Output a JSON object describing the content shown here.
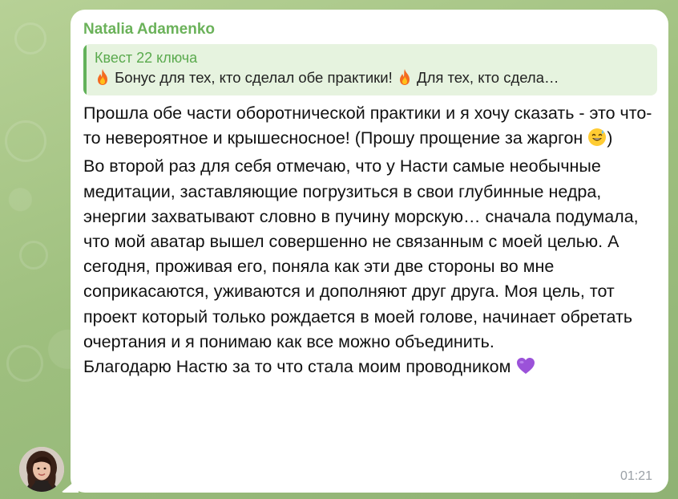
{
  "chat": {
    "sender_name": "Natalia Adamenko",
    "reply": {
      "title": "Квест 22 ключа",
      "text": "Бонус для тех, кто сделал обе практики!",
      "text_tail": "Для тех, кто сдела…"
    },
    "message": {
      "line_1": "Прошла обе части оборотнической практики и я хочу сказать - это что-то невероятное и крышесносное! (Прошу прощение за жаргон",
      "line_1_end": ")",
      "line_2": "Во второй раз для себя отмечаю, что у Насти самые необычные медитации, заставляющие погрузиться в свои глубинные недра, энергии захватывают словно в пучину морскую… сначала подумала, что мой аватар вышел совершенно не связанным с моей целью. А сегодня, проживая его, поняла как эти две стороны во мне соприкасаются, уживаются и дополняют друг друга. Моя цель, тот проект который только рождается в моей голове, начинает обретать очертания и я понимаю как все можно объединить.",
      "line_3": "Благодарю Настю за то что стала моим проводником"
    },
    "time": "01:21"
  },
  "icons": {
    "fire": "fire-emoji",
    "sweat_smile": "sweat-smile-emoji",
    "purple_heart": "purple-heart-emoji",
    "avatar": "user-avatar"
  },
  "colors": {
    "sender": "#6bb25a",
    "reply_bar": "#63b25a",
    "reply_bg": "#e6f3df",
    "bubble": "#ffffff",
    "timestamp": "#9aa0a6"
  }
}
